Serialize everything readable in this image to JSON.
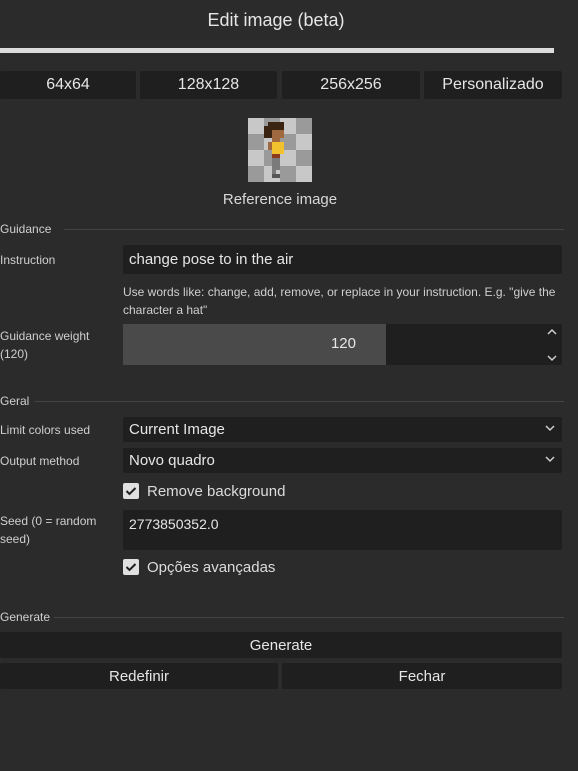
{
  "dialog": {
    "title": "Edit image (beta)",
    "progress": 1.0
  },
  "sizes": [
    {
      "label": "64x64"
    },
    {
      "label": "128x128"
    },
    {
      "label": "256x256"
    },
    {
      "label": "Personalizado"
    }
  ],
  "reference": {
    "label": "Reference image"
  },
  "guidance": {
    "section_title": "Guidance",
    "instruction_label": "Instruction",
    "instruction_value": "change pose to in the air",
    "hint": "Use words like: change, add, remove, or replace in your instruction. E.g. \"give the character a hat\"",
    "weight_label": "Guidance weight (120)",
    "weight_value": "120",
    "weight_fraction": 0.6
  },
  "general": {
    "section_title": "Geral",
    "limit_colors_label": "Limit colors used",
    "limit_colors_value": "Current Image",
    "output_method_label": "Output method",
    "output_method_value": "Novo quadro",
    "remove_bg_label": "Remove background",
    "remove_bg_checked": true,
    "seed_label": "Seed (0 = random seed)",
    "seed_value": "2773850352.0",
    "advanced_label": "Opções avançadas",
    "advanced_checked": true
  },
  "generate": {
    "section_title": "Generate",
    "generate_label": "Generate",
    "reset_label": "Redefinir",
    "close_label": "Fechar"
  },
  "colors": {
    "background": "#2b2b2b",
    "input": "#1f1f1f",
    "slider_fill": "#4a4a4a",
    "accent_char": "#f2c12e"
  }
}
